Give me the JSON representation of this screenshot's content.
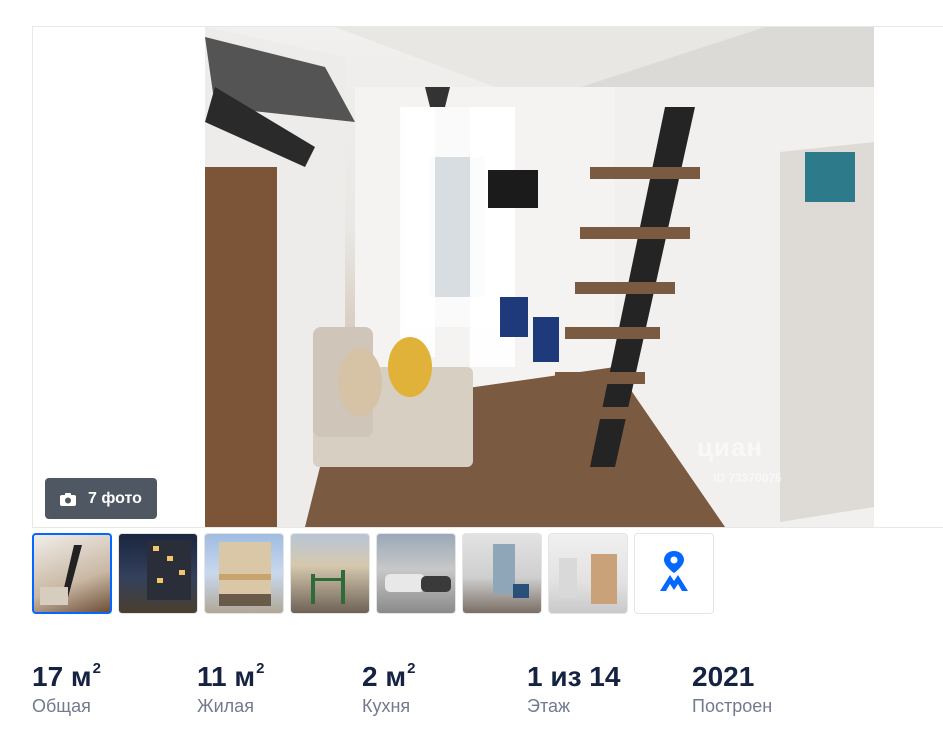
{
  "gallery": {
    "photo_count_label": "7 фото",
    "watermark": "циан",
    "watermark_id": "ID 73370075",
    "thumbnails": [
      {
        "label": "interior-loft"
      },
      {
        "label": "building-night"
      },
      {
        "label": "building-facade"
      },
      {
        "label": "playground"
      },
      {
        "label": "parking"
      },
      {
        "label": "lobby"
      },
      {
        "label": "hallway"
      }
    ],
    "map_icon": "map-pin-icon",
    "accent_color": "#0468ff"
  },
  "facts": [
    {
      "value": "17 м",
      "sup": "2",
      "label": "Общая"
    },
    {
      "value": "11 м",
      "sup": "2",
      "label": "Жилая"
    },
    {
      "value": "2 м",
      "sup": "2",
      "label": "Кухня"
    },
    {
      "value": "1 из 14",
      "sup": "",
      "label": "Этаж"
    },
    {
      "value": "2021",
      "sup": "",
      "label": "Построен"
    }
  ]
}
